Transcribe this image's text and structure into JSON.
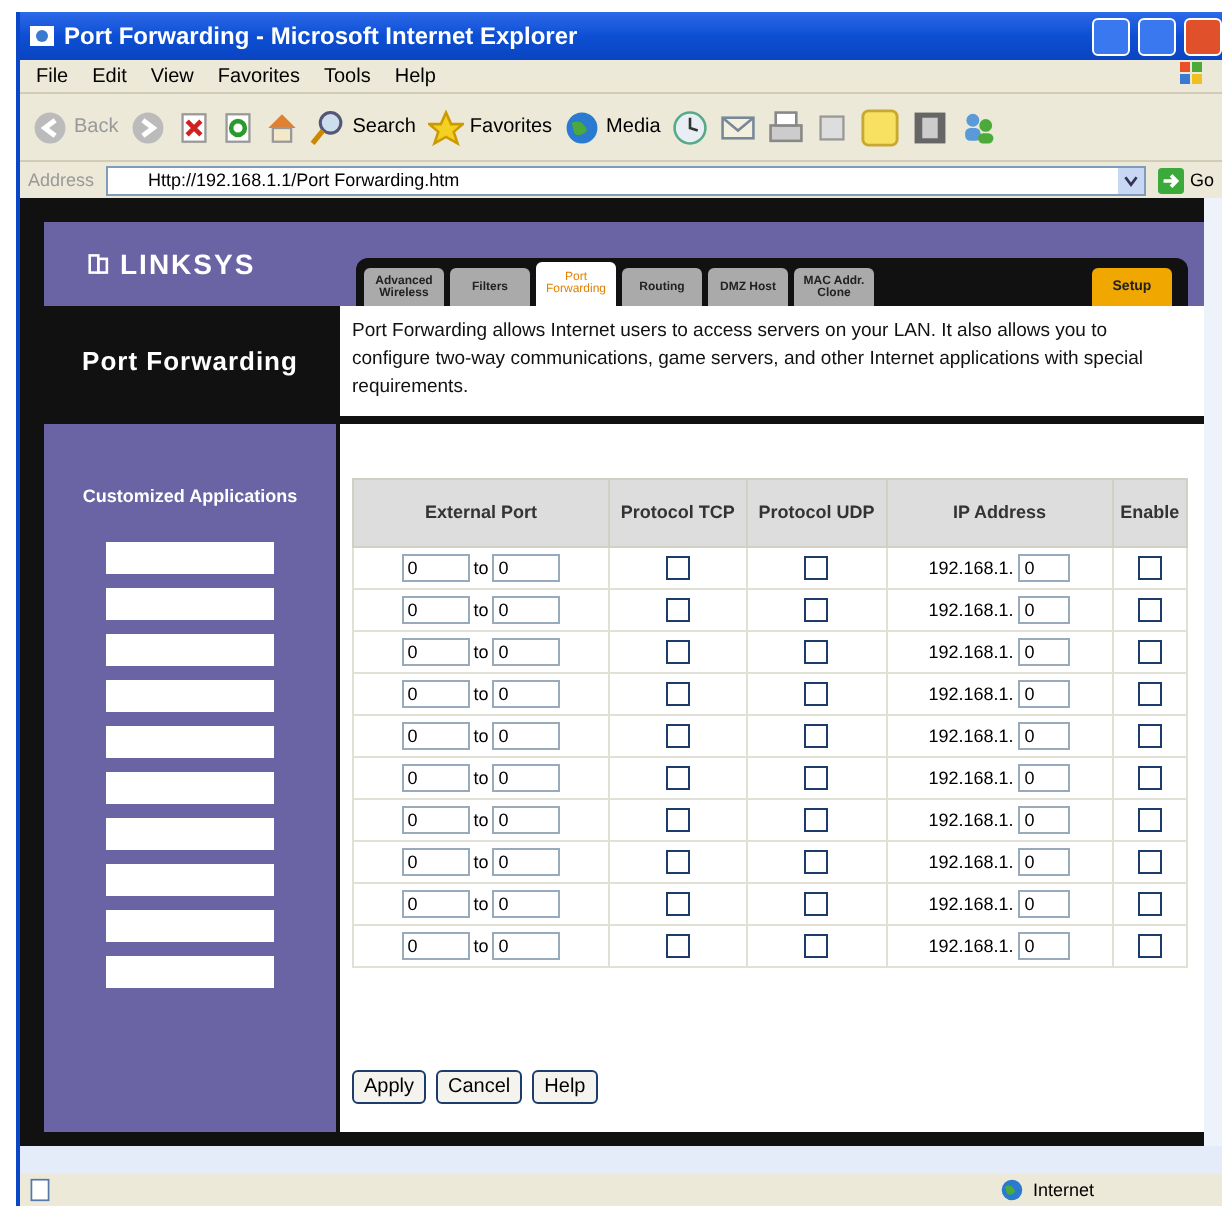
{
  "window": {
    "title": "Port Forwarding - Microsoft Internet Explorer"
  },
  "menu": [
    "File",
    "Edit",
    "View",
    "Favorites",
    "Tools",
    "Help"
  ],
  "toolbar": {
    "back": "Back",
    "search": "Search",
    "favorites": "Favorites",
    "media": "Media"
  },
  "address": {
    "label": "Address",
    "value": "Http://192.168.1.1/Port Forwarding.htm",
    "go": "Go"
  },
  "logo": "LINKSYS",
  "tabs": [
    {
      "label": "Advanced Wireless",
      "selected": false
    },
    {
      "label": "Filters",
      "selected": false
    },
    {
      "label": "Port Forwarding",
      "selected": true
    },
    {
      "label": "Routing",
      "selected": false
    },
    {
      "label": "DMZ Host",
      "selected": false
    },
    {
      "label": "MAC Addr. Clone",
      "selected": false
    }
  ],
  "setup_tab": "Setup",
  "section_title": "Port Forwarding",
  "description": "Port Forwarding allows Internet users to access servers on your LAN. It also allows you to configure two-way communications, game servers, and other Internet applications with special requirements.",
  "sidebar": {
    "title": "Customized Applications"
  },
  "table": {
    "columns": [
      "External Port",
      "Protocol TCP",
      "Protocol UDP",
      "IP Address",
      "Enable"
    ],
    "rows": [
      {
        "from": "0",
        "to_label": "to",
        "to": "0",
        "tcp": false,
        "udp": false,
        "ip_prefix": "192.168.1.",
        "ip": "0",
        "enable": false
      },
      {
        "from": "0",
        "to_label": "to",
        "to": "0",
        "tcp": false,
        "udp": false,
        "ip_prefix": "192.168.1.",
        "ip": "0",
        "enable": false
      },
      {
        "from": "0",
        "to_label": "to",
        "to": "0",
        "tcp": false,
        "udp": false,
        "ip_prefix": "192.168.1.",
        "ip": "0",
        "enable": false
      },
      {
        "from": "0",
        "to_label": "to",
        "to": "0",
        "tcp": false,
        "udp": false,
        "ip_prefix": "192.168.1.",
        "ip": "0",
        "enable": false
      },
      {
        "from": "0",
        "to_label": "to",
        "to": "0",
        "tcp": false,
        "udp": false,
        "ip_prefix": "192.168.1.",
        "ip": "0",
        "enable": false
      },
      {
        "from": "0",
        "to_label": "to",
        "to": "0",
        "tcp": false,
        "udp": false,
        "ip_prefix": "192.168.1.",
        "ip": "0",
        "enable": false
      },
      {
        "from": "0",
        "to_label": "to",
        "to": "0",
        "tcp": false,
        "udp": false,
        "ip_prefix": "192.168.1.",
        "ip": "0",
        "enable": false
      },
      {
        "from": "0",
        "to_label": "to",
        "to": "0",
        "tcp": false,
        "udp": false,
        "ip_prefix": "192.168.1.",
        "ip": "0",
        "enable": false
      },
      {
        "from": "0",
        "to_label": "to",
        "to": "0",
        "tcp": false,
        "udp": false,
        "ip_prefix": "192.168.1.",
        "ip": "0",
        "enable": false
      },
      {
        "from": "0",
        "to_label": "to",
        "to": "0",
        "tcp": false,
        "udp": false,
        "ip_prefix": "192.168.1.",
        "ip": "0",
        "enable": false
      }
    ]
  },
  "buttons": [
    "Apply",
    "Cancel",
    "Help"
  ],
  "status_bar": {
    "zone": "Internet"
  }
}
